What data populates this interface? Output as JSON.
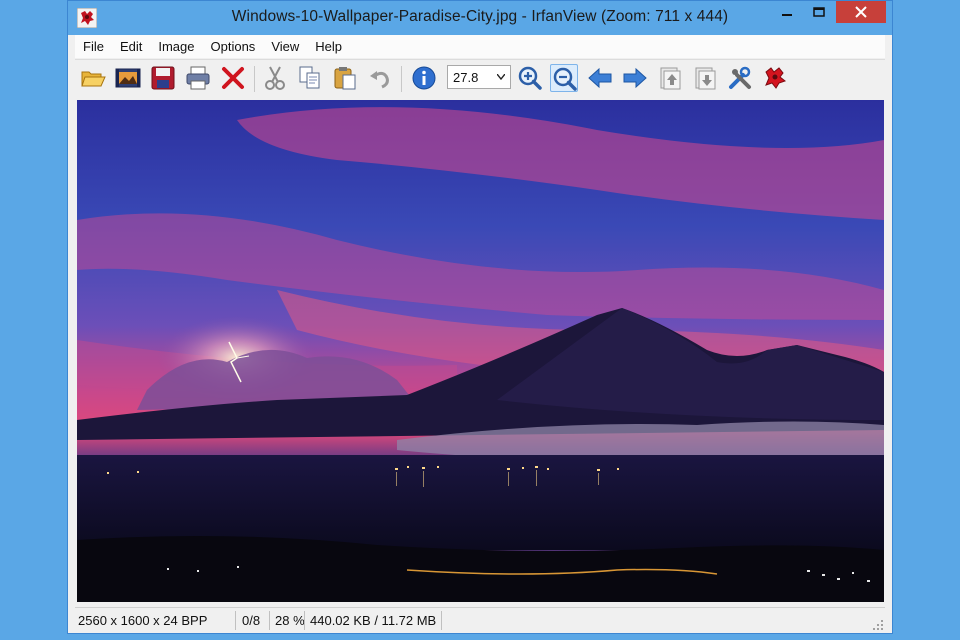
{
  "window": {
    "title": "Windows-10-Wallpaper-Paradise-City.jpg - IrfanView (Zoom: 711 x 444)"
  },
  "menu": [
    "File",
    "Edit",
    "Image",
    "Options",
    "View",
    "Help"
  ],
  "toolbar": {
    "buttons": [
      {
        "name": "open-icon"
      },
      {
        "name": "slideshow-icon"
      },
      {
        "name": "save-icon"
      },
      {
        "name": "print-icon"
      },
      {
        "name": "delete-icon"
      },
      {
        "name": "cut-icon"
      },
      {
        "name": "copy-icon"
      },
      {
        "name": "paste-icon"
      },
      {
        "name": "undo-icon"
      },
      {
        "name": "info-icon"
      },
      {
        "name": "zoom-in-icon"
      },
      {
        "name": "zoom-out-icon"
      },
      {
        "name": "previous-icon"
      },
      {
        "name": "next-icon"
      },
      {
        "name": "first-page-icon"
      },
      {
        "name": "last-page-icon"
      },
      {
        "name": "properties-icon"
      },
      {
        "name": "irfanview-logo-icon"
      }
    ],
    "zoom_value": "27.8"
  },
  "status": {
    "dimensions": "2560 x 1600 x 24 BPP",
    "index": "0/8",
    "zoom": "28 %",
    "size": "440.02 KB / 11.72 MB"
  },
  "colors": {
    "titlebar": "#5aa7e6",
    "close": "#c7403a",
    "sky_top": "#2b2f9e",
    "sky_pink": "#e0487a"
  }
}
